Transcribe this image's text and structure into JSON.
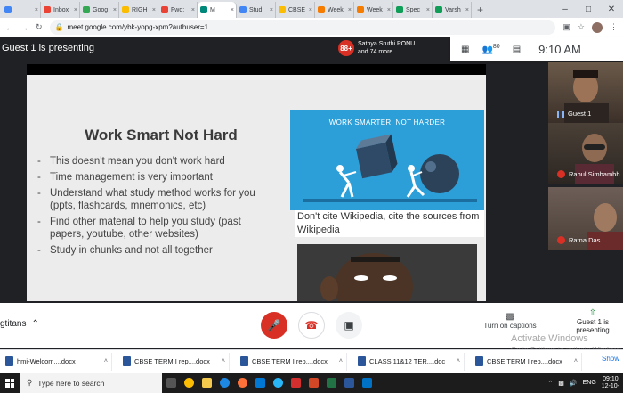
{
  "browser": {
    "tabs": [
      {
        "label": "",
        "color": "#4285f4"
      },
      {
        "label": "Inbox",
        "color": "#ea4335"
      },
      {
        "label": "Goog",
        "color": "#34a853"
      },
      {
        "label": "RIGH",
        "color": "#fbbc04"
      },
      {
        "label": "Fwd:",
        "color": "#ea4335"
      },
      {
        "label": "M",
        "color": "#00897b",
        "active": true
      },
      {
        "label": "Stud",
        "color": "#4285f4"
      },
      {
        "label": "CBSE",
        "color": "#fbbc04"
      },
      {
        "label": "Week",
        "color": "#f57c00"
      },
      {
        "label": "Week",
        "color": "#f57c00"
      },
      {
        "label": "Spec",
        "color": "#0f9d58"
      },
      {
        "label": "Varsh",
        "color": "#0f9d58"
      }
    ],
    "url": "meet.google.com/ybk-yopg-xpm?authuser=1"
  },
  "meet": {
    "presenting_label": "Guest 1 is presenting",
    "presenter": {
      "badge": "88+",
      "name": "Sathya Sruthi PONU...",
      "more": "and 74 more"
    },
    "participant_count": "80",
    "time": "9:10 AM",
    "meeting_code": "gtitans",
    "captions_label": "Turn on captions",
    "presenting_button": "Guest 1 is presenting",
    "participants": [
      {
        "name": "Guest 1"
      },
      {
        "name": "Rahul Simhambh"
      },
      {
        "name": "Ratna Das"
      }
    ]
  },
  "slide": {
    "title": "Work Smart Not Hard",
    "bullets": [
      "This doesn't mean you don't work hard",
      "Time management is very important",
      "Understand what study method works for you (ppts, flashcards, mnemonics, etc)",
      "Find other material to help you study (past papers, youtube, other websites)",
      "Study in chunks and not all together"
    ],
    "image_text": "WORK SMARTER, NOT HARDER",
    "caption": "Don't cite Wikipedia, cite the sources from Wikipedia"
  },
  "watermark": {
    "line1": "Activate Windows",
    "line2": "Go to Settings to activate Windows"
  },
  "downloads": [
    {
      "name": "hmi-Welcom....docx"
    },
    {
      "name": "CBSE TERM I rep....docx"
    },
    {
      "name": "CBSE TERM I rep....docx"
    },
    {
      "name": "CLASS 11&12 TER....doc"
    },
    {
      "name": "CBSE TERM I rep....docx"
    }
  ],
  "downloads_show_all": "Show",
  "taskbar": {
    "search_placeholder": "Type here to search",
    "lang": "ENG",
    "clock_time": "09:10",
    "clock_date": "12-10-"
  },
  "colors": {
    "accent_red": "#d93025",
    "slide_blue": "#2c9ed8"
  }
}
